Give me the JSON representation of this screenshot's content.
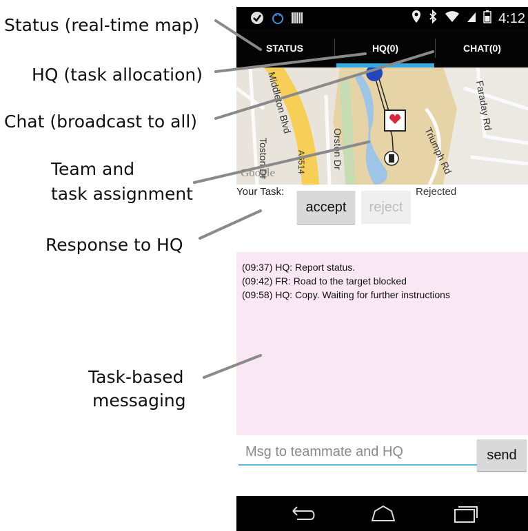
{
  "callouts": {
    "status": "Status (real-time map)",
    "hq": "HQ (task allocation)",
    "chat": "Chat (broadcast to all)",
    "team_line1": "Team and",
    "team_line2": "task assignment",
    "response": "Response to HQ",
    "messaging_line1": "Task-based",
    "messaging_line2": "messaging"
  },
  "statusbar": {
    "time": "4:12"
  },
  "tabs": [
    {
      "label": "STATUS"
    },
    {
      "label": "HQ(0)"
    },
    {
      "label": "CHAT(0)"
    }
  ],
  "map": {
    "streets": [
      "Middleton Blvd",
      "Orston Dr",
      "Toston Dr",
      "Faraday Rd",
      "Triumph Rd",
      "A6514"
    ],
    "watermark": "Google"
  },
  "task": {
    "label": "Your Task:",
    "accept_label": "accept",
    "reject_label": "reject",
    "status": "Rejected"
  },
  "messages": [
    "(09:37) HQ: Report status.",
    "(09:42) FR:  Road to the target blocked",
    "(09:58) HQ: Copy. Waiting for further instructions"
  ],
  "composer": {
    "placeholder": "Msg to teammate and HQ",
    "send_label": "send"
  },
  "colors": {
    "tab_indicator": "#36a9e0",
    "messages_bg": "#f9e8f3",
    "input_underline": "#5ab6dc"
  },
  "icons": [
    "check-circle-icon",
    "android-icon",
    "barcode-icon",
    "location-pin-icon",
    "bluetooth-icon",
    "wifi-icon",
    "signal-icon",
    "battery-icon",
    "back-icon",
    "home-icon",
    "recents-icon"
  ]
}
